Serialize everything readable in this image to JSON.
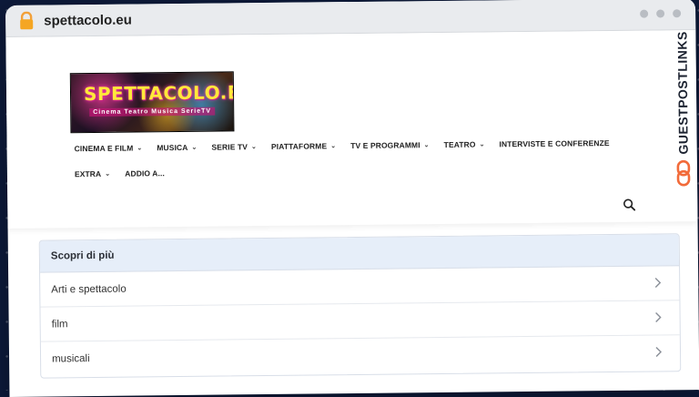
{
  "browser": {
    "url": "spettacolo.eu"
  },
  "site": {
    "logo_title": "SPETTACOLO.EU",
    "logo_tagline": "Cinema Teatro Musica SerieTV",
    "nav": [
      {
        "label": "CINEMA E FILM",
        "has_dropdown": true
      },
      {
        "label": "MUSICA",
        "has_dropdown": true
      },
      {
        "label": "SERIE TV",
        "has_dropdown": true
      },
      {
        "label": "PIATTAFORME",
        "has_dropdown": true
      },
      {
        "label": "TV E PROGRAMMI",
        "has_dropdown": true
      },
      {
        "label": "TEATRO",
        "has_dropdown": true
      },
      {
        "label": "INTERVISTE E CONFERENZE",
        "has_dropdown": false
      },
      {
        "label": "EXTRA",
        "has_dropdown": true
      },
      {
        "label": "ADDIO A...",
        "has_dropdown": false
      }
    ],
    "search_icon": "search-icon"
  },
  "discover": {
    "heading": "Scopri di più",
    "items": [
      {
        "label": "Arti e spettacolo"
      },
      {
        "label": "film"
      },
      {
        "label": "musicali"
      }
    ]
  },
  "watermark": {
    "text": "GUESTPOSTLINKS"
  },
  "colors": {
    "accent_orange": "#f26b3a",
    "card_header_bg": "#e6eef9",
    "page_bg": "#0d1a3a"
  }
}
